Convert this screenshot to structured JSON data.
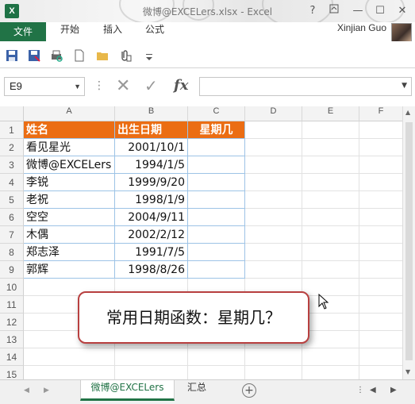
{
  "window": {
    "app_icon": "X",
    "title": "微博@EXCELers.xlsx - Excel",
    "help_label": "?",
    "restore_icon": "ribbon-display-icon",
    "minimize_label": "—",
    "maximize_label": "☐",
    "close_label": "✕"
  },
  "ribbon": {
    "file_tab": "文件",
    "tabs": [
      "开始",
      "插入",
      "公式"
    ],
    "user_name": "Xinjian Guo"
  },
  "qat": {
    "buttons": [
      "save-icon",
      "save-as-icon",
      "print-preview-icon",
      "new-document-icon",
      "open-folder-icon",
      "attach-icon",
      "customize-dropdown-icon"
    ]
  },
  "formula_bar": {
    "name_box": "E9",
    "formula": "",
    "fx_label": "fx"
  },
  "grid": {
    "columns": [
      "A",
      "B",
      "C",
      "D",
      "E",
      "F"
    ],
    "rows": [
      "1",
      "2",
      "3",
      "4",
      "5",
      "6",
      "7",
      "8",
      "9",
      "10",
      "11",
      "12",
      "13",
      "14",
      "15"
    ],
    "headers": [
      "姓名",
      "出生日期",
      "星期几"
    ],
    "data": [
      [
        "看见星光",
        "2001/10/1",
        ""
      ],
      [
        "微博@EXCELers",
        "1994/1/5",
        ""
      ],
      [
        "李锐",
        "1999/9/20",
        ""
      ],
      [
        "老祝",
        "1998/1/9",
        ""
      ],
      [
        "空空",
        "2004/9/11",
        ""
      ],
      [
        "木偶",
        "2002/2/12",
        ""
      ],
      [
        "郑志泽",
        "1991/7/5",
        ""
      ],
      [
        "郭辉",
        "1998/8/26",
        ""
      ]
    ],
    "header_color": "#eb6d13"
  },
  "callout": {
    "text": "常用日期函数：星期几？"
  },
  "sheets": {
    "tabs": [
      "微博@EXCELers",
      "汇总"
    ],
    "active": "微博@EXCELers",
    "add_label": "+"
  },
  "colors": {
    "excel_green": "#217346",
    "table_border": "#9dc3e6"
  }
}
